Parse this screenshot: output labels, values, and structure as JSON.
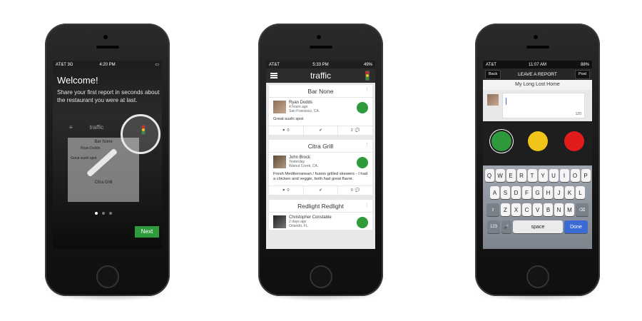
{
  "phone1": {
    "status": {
      "carrier": "AT&T 3G",
      "time": "4:20 PM"
    },
    "welcome": "Welcome!",
    "intro": "Share your first report in seconds about the restaurant you were at last.",
    "mini": {
      "title": "traffic",
      "card_title": "Bar None",
      "card_title2": "Citra Grill",
      "user": "Ryan Dodds",
      "text": "Great sushi spot"
    },
    "next_label": "Next"
  },
  "phone2": {
    "status": {
      "carrier": "AT&T",
      "time": "5:33 PM",
      "battery": "49%"
    },
    "app_title": "traffic",
    "reports": [
      {
        "title": "Bar None",
        "user": "Ryan Dodds",
        "time": "4 hours ago",
        "location": "San Francisco, CA.",
        "text": "Great sushi spot",
        "likes": "0",
        "comments": "2"
      },
      {
        "title": "Citra Grill",
        "user": "John Brock",
        "time": "Yesterday",
        "location": "Walnut Creek, CA.",
        "text": "Fresh Mediterranean / fusion grilled skewers - I had a chicken and veggie, both had great flavor.",
        "likes": "0",
        "comments": "0"
      },
      {
        "title": "Redlight Redlight",
        "user": "Christopher Constable",
        "time": "2 days ago",
        "location": "Orlando, FL."
      }
    ]
  },
  "phone3": {
    "status": {
      "carrier": "AT&T",
      "time": "11:07 AM",
      "battery": "88%"
    },
    "back_label": "Back",
    "title": "LEAVE A REPORT",
    "post_label": "Post",
    "location": "My Long Lost Home",
    "char_count": "120",
    "keyboard": {
      "row1": [
        "Q",
        "W",
        "E",
        "R",
        "T",
        "Y",
        "U",
        "I",
        "O",
        "P"
      ],
      "row2": [
        "A",
        "S",
        "D",
        "F",
        "G",
        "H",
        "J",
        "K",
        "L"
      ],
      "row3": [
        "Z",
        "X",
        "C",
        "V",
        "B",
        "N",
        "M"
      ],
      "num_label": "123",
      "space_label": "space",
      "done_label": "Done"
    }
  }
}
